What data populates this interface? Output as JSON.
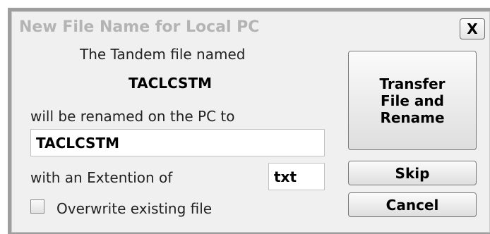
{
  "dialog": {
    "title": "New File Name for Local PC",
    "close_label": "X",
    "intro_text": "The Tandem file named",
    "source_filename": "TACLCSTM",
    "rename_text": "will be renamed on the PC to",
    "new_filename_value": "TACLCSTM",
    "extension_label": "with an Extention of",
    "extension_value": "txt",
    "overwrite_label": "Overwrite existing file",
    "overwrite_checked": false,
    "buttons": {
      "transfer_line1": "Transfer",
      "transfer_line2": "File and",
      "transfer_line3": "Rename",
      "skip": "Skip",
      "cancel": "Cancel"
    }
  }
}
